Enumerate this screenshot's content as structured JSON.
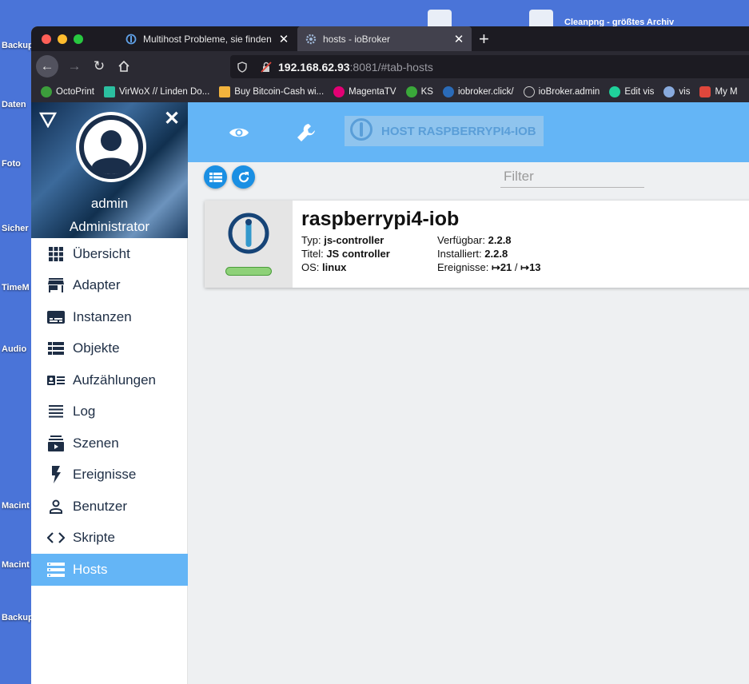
{
  "desktop": {
    "labels": [
      "Backup",
      "Daten",
      "Foto",
      "Sicher",
      "TimeM",
      "Audio",
      "Macint",
      "Macint",
      "Backup"
    ],
    "top_text": "Cleanpng - größtes Archiv"
  },
  "browser": {
    "tabs": [
      {
        "title": "Multihost Probleme, sie finden",
        "active": false
      },
      {
        "title": "hosts - ioBroker",
        "active": true
      }
    ],
    "url": {
      "host": "192.168.62.93",
      "rest": ":8081/#tab-hosts"
    },
    "bookmarks": [
      {
        "label": "OctoPrint",
        "color": "#3c9e3c"
      },
      {
        "label": "VirWoX // Linden Do...",
        "color": "#2bbfa0"
      },
      {
        "label": "Buy Bitcoin-Cash wi...",
        "color": "#f2b33d"
      },
      {
        "label": "MagentaTV",
        "color": "#e20074"
      },
      {
        "label": "KS",
        "color": "#3aa83a"
      },
      {
        "label": "iobroker.click/",
        "color": "#2a6bb8"
      },
      {
        "label": "ioBroker.admin",
        "color": "#cccccc"
      },
      {
        "label": "Edit vis",
        "color": "#1fd19a"
      },
      {
        "label": "vis",
        "color": "#88aadd"
      },
      {
        "label": "My M",
        "color": "#e0473c"
      }
    ]
  },
  "sidebar": {
    "user_name": "admin",
    "user_role": "Administrator",
    "items": [
      {
        "label": "Übersicht",
        "icon": "grid-icon"
      },
      {
        "label": "Adapter",
        "icon": "store-icon"
      },
      {
        "label": "Instanzen",
        "icon": "subtitles-icon"
      },
      {
        "label": "Objekte",
        "icon": "list-view-icon"
      },
      {
        "label": "Aufzählungen",
        "icon": "contact-card-icon"
      },
      {
        "label": "Log",
        "icon": "lines-icon"
      },
      {
        "label": "Szenen",
        "icon": "subscriptions-icon"
      },
      {
        "label": "Ereignisse",
        "icon": "flash-icon"
      },
      {
        "label": "Benutzer",
        "icon": "person-icon"
      },
      {
        "label": "Skripte",
        "icon": "code-icon"
      },
      {
        "label": "Hosts",
        "icon": "storage-icon",
        "active": true
      }
    ]
  },
  "toolbar": {
    "host_tab_label": "HOST RASPBERRYPI4-IOB"
  },
  "filter": {
    "placeholder": "Filter"
  },
  "host": {
    "name": "raspberrypi4-iob",
    "typ_label": "Typ:",
    "typ": "js-controller",
    "titel_label": "Titel:",
    "titel": "JS controller",
    "os_label": "OS:",
    "os": "linux",
    "verfuegbar_label": "Verfügbar:",
    "verfuegbar": "2.2.8",
    "installiert_label": "Installiert:",
    "installiert": "2.2.8",
    "ereignisse_label": "Ereignisse:",
    "ereignisse_in": "↦21",
    "ereignisse_sep": "/",
    "ereignisse_out": "↦13",
    "status_color": "#8ed178"
  },
  "colors": {
    "accent": "#64b5f6",
    "button_blue": "#1a8fe3",
    "sidebar_text": "#1e2e45"
  }
}
